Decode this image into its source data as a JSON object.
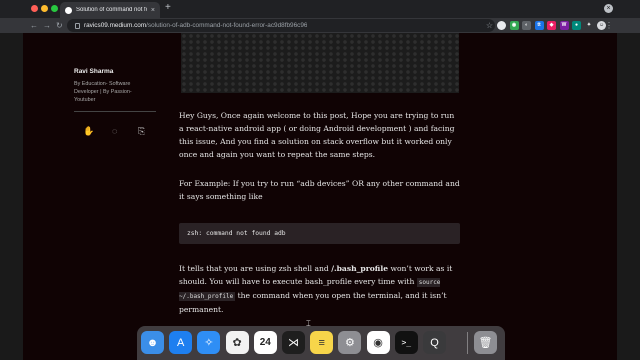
{
  "browser": {
    "tab_title": "Solution of command not found",
    "new_tab": "+",
    "close_tab": "×",
    "window_control": "×",
    "url_host": "ravics09.medium.com",
    "url_path": "/solution-of-adb-command-not-found-error-ac9d8fb96c96",
    "nav_back": "←",
    "nav_forward": "→",
    "nav_reload": "↻",
    "star": "☆",
    "menu": "⋮",
    "extensions": [
      {
        "icon": "account-icon",
        "color": "#e8eaed",
        "label": ""
      },
      {
        "icon": "extension-green-icon",
        "color": "#34a853",
        "label": "◉"
      },
      {
        "icon": "extension-grey-icon",
        "color": "#5f6368",
        "label": "◐"
      },
      {
        "icon": "extension-blue-icon",
        "color": "#1a73e8",
        "label": "tt"
      },
      {
        "icon": "extension-pink-icon",
        "color": "#e91e63",
        "label": "◆"
      },
      {
        "icon": "extension-purple-icon",
        "color": "#7b1fa2",
        "label": "W"
      },
      {
        "icon": "extension-teal-icon",
        "color": "#00897b",
        "label": "●"
      },
      {
        "icon": "puzzle-icon",
        "color": "#35363a",
        "label": "✦"
      },
      {
        "icon": "profile-icon",
        "color": "#dadce0",
        "label": "☺"
      }
    ]
  },
  "sidebar": {
    "author": "Ravi Sharma",
    "bio": "By Education- Software Developer | By Passion- Youtuber",
    "icons": [
      "clap-icon",
      "comment-icon",
      "bookmark-icon"
    ],
    "clap_glyph": "✋",
    "comment_glyph": "◌",
    "bookmark_glyph": "⎘"
  },
  "article": {
    "p1": "Hey Guys, Once again welcome to this post, Hope you are trying to run a react-native android app ( or doing Android development ) and facing this issue, And you find a solution on stack overflow but it worked only once and again you want to repeat the same steps.",
    "p2": "For Example: If you try to run “adb devices” OR any other command and it says something like",
    "code": "zsh: command not found adb",
    "p3_a": "It tells that you are using zsh shell and ",
    "p3_bold": "/.bash_profile",
    "p3_b": " won’t work as it should. You will have to execute bash_profile every time with ",
    "p3_code": "source ~/.bash_profile",
    "p3_c": " the command when you open the terminal, and it isn’t permanent."
  },
  "dock": {
    "apps": [
      {
        "name": "finder-icon",
        "color": "#3b8ee8",
        "glyph": "☻"
      },
      {
        "name": "app-store-icon",
        "color": "#1e7ff0",
        "glyph": "A"
      },
      {
        "name": "safari-icon",
        "color": "#2f8ef5",
        "glyph": "✧"
      },
      {
        "name": "photos-icon",
        "color": "#f2f2f2",
        "glyph": "✿"
      },
      {
        "name": "calendar-icon",
        "color": "#ffffff",
        "glyph": "24"
      },
      {
        "name": "vscode-icon",
        "color": "#1e1e1e",
        "glyph": "⋊"
      },
      {
        "name": "notes-icon",
        "color": "#f7d54a",
        "glyph": "≡"
      },
      {
        "name": "system-preferences-icon",
        "color": "#8e8e93",
        "glyph": "⚙"
      },
      {
        "name": "chrome-icon",
        "color": "#ffffff",
        "glyph": "◉"
      },
      {
        "name": "terminal-icon",
        "color": "#111111",
        "glyph": ">_"
      },
      {
        "name": "quicktime-icon",
        "color": "#3a3a3c",
        "glyph": "Q"
      },
      {
        "name": "trash-icon",
        "color": "#8e8e93",
        "glyph": "🗑"
      }
    ]
  }
}
